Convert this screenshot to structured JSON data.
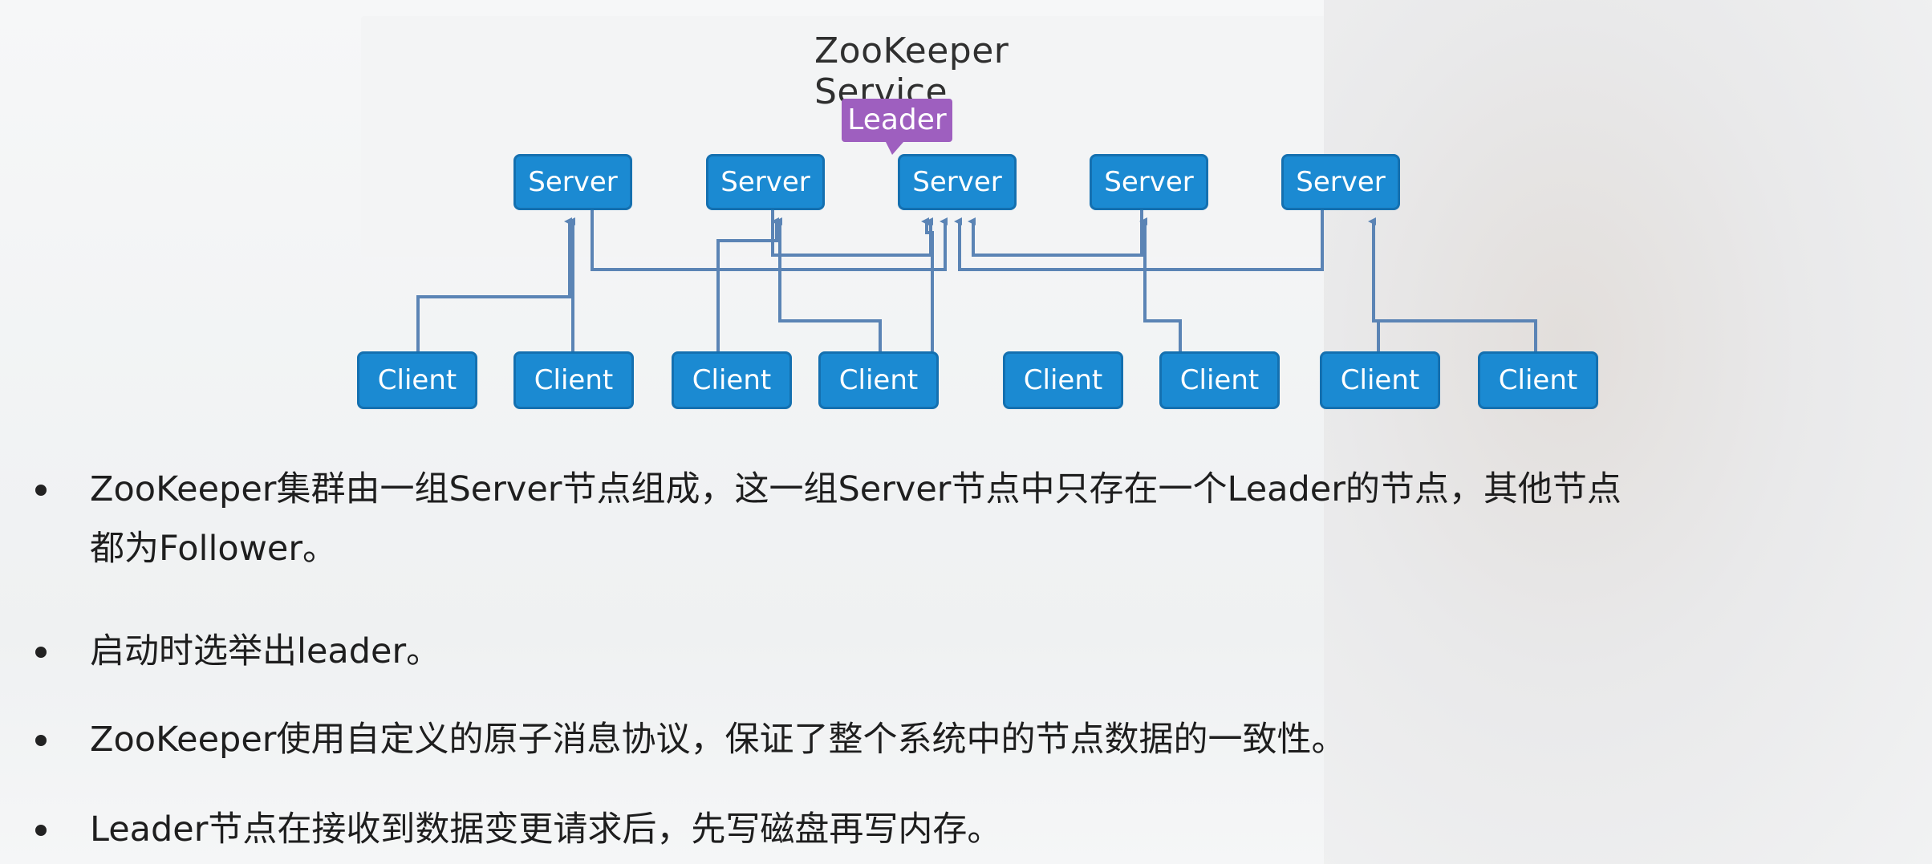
{
  "diagram": {
    "title": "ZooKeeper Service",
    "leader_label": "Leader",
    "servers": [
      "Server",
      "Server",
      "Server",
      "Server",
      "Server"
    ],
    "clients": [
      "Client",
      "Client",
      "Client",
      "Client",
      "Client",
      "Client",
      "Client",
      "Client"
    ],
    "colors": {
      "node_fill": "#1b8ad2",
      "node_border": "#1470b0",
      "connector": "#5b84b5",
      "leader_tag": "#9e5fbf"
    }
  },
  "bullets": [
    {
      "line1": "ZooKeeper集群由一组Server节点组成，这一组Server节点中只存在一个Leader的节点，其他节点",
      "line2": "都为Follower。"
    },
    {
      "line1": "启动时选举出leader。"
    },
    {
      "line1": "ZooKeeper使用自定义的原子消息协议，保证了整个系统中的节点数据的一致性。"
    },
    {
      "line1": "Leader节点在接收到数据变更请求后，先写磁盘再写内存。"
    }
  ]
}
